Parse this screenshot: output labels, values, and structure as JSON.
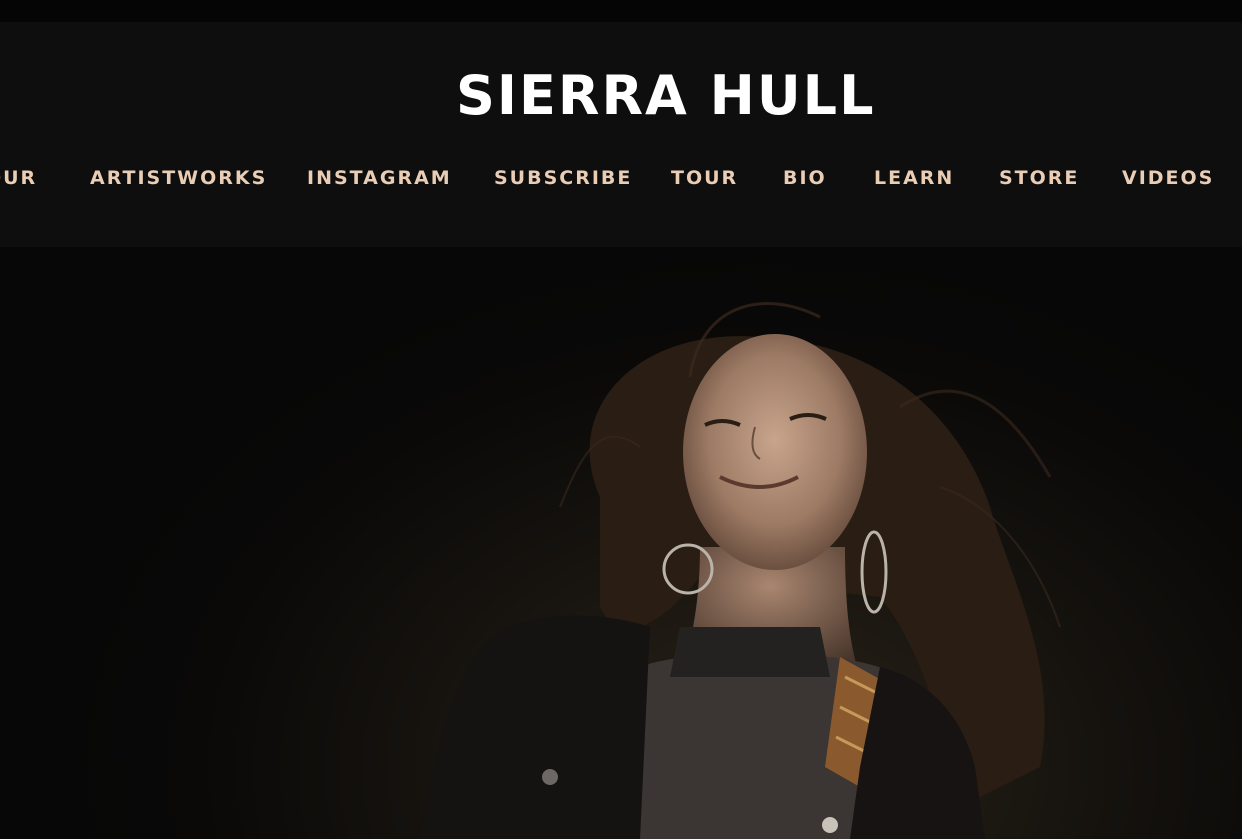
{
  "header": {
    "site_title": "SIERRA HULL"
  },
  "nav": {
    "items": [
      {
        "label": "TOUR"
      },
      {
        "label": "ARTISTWORKS"
      },
      {
        "label": "INSTAGRAM"
      },
      {
        "label": "SUBSCRIBE"
      },
      {
        "label": "TOUR"
      },
      {
        "label": "BIO"
      },
      {
        "label": "LEARN"
      },
      {
        "label": "STORE"
      },
      {
        "label": "VIDEOS"
      }
    ]
  },
  "colors": {
    "header_bg": "#0e0e0e",
    "title": "#ffffff",
    "nav_text": "#e9cdb5",
    "hero_bg": "#17140f"
  },
  "hero": {
    "image_subject": "artist-portrait"
  }
}
